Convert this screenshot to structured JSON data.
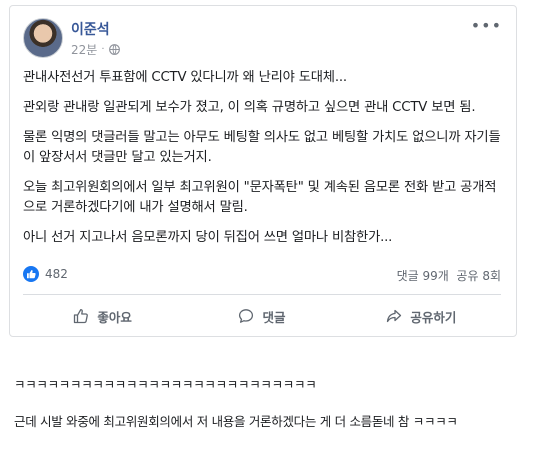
{
  "post": {
    "author": "이준석",
    "time": "22분",
    "separator": "·",
    "paragraphs": [
      "관내사전선거 투표함에 CCTV 있다니까 왜 난리야 도대체...",
      "관외랑 관내랑 일관되게 보수가 졌고, 이 의혹 규명하고 싶으면 관내 CCTV 보면 됨.",
      "물론 익명의 댓글러들 말고는 아무도 베팅할 의사도 없고 베팅할 가치도 없으니까 자기들이 앞장서서 댓글만 달고 있는거지.",
      "오늘 최고위원회의에서 일부 최고위원이 \"문자폭탄\" 및 계속된 음모론 전화 받고 공개적으로 거론하겠다기에 내가 설명해서 말림.",
      "아니 선거 지고나서 음모론까지 당이 뒤집어 쓰면 얼마나 비참한가..."
    ],
    "reaction_count": "482",
    "comment_count": "댓글 99개",
    "share_count": "공유 8회"
  },
  "actions": {
    "like": "좋아요",
    "comment": "댓글",
    "share": "공유하기"
  },
  "comments": [
    "ㅋㅋㅋㅋㅋㅋㅋㅋㅋㅋㅋㅋㅋㅋㅋㅋㅋㅋㅋㅋㅋㅋㅋㅋㅋㅋㅋ",
    "근데 시발 와중에 최고위원회의에서 저 내용을 거론하겠다는 게 더 소름돋네 참 ㅋㅋㅋㅋ"
  ],
  "colors": {
    "link_blue": "#385898",
    "like_blue": "#1877f2",
    "muted_text": "#606770",
    "border": "#dddfe2"
  }
}
